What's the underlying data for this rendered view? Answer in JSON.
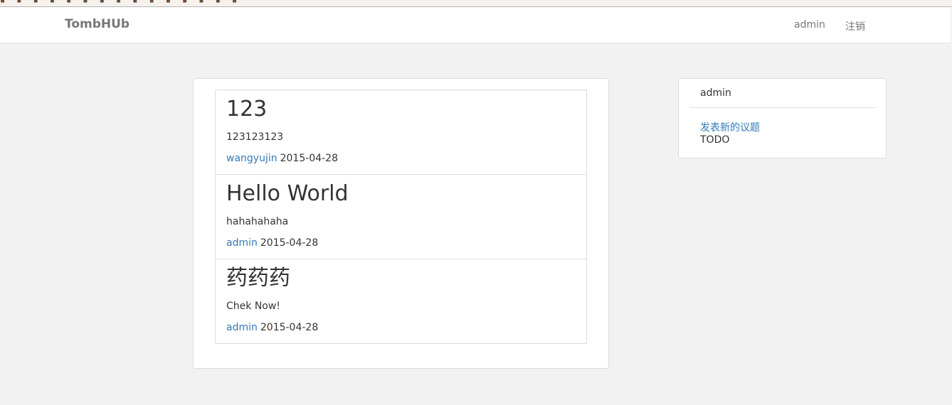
{
  "navbar": {
    "brand": "TombHUb",
    "user_link": "admin",
    "logout_link": "注销"
  },
  "topics": [
    {
      "title": "123",
      "body": "123123123",
      "author": "wangyujin",
      "date": "2015-04-28"
    },
    {
      "title": "Hello World",
      "body": "hahahahaha",
      "author": "admin",
      "date": "2015-04-28"
    },
    {
      "title": "药药药",
      "body": "Chek Now!",
      "author": "admin",
      "date": "2015-04-28"
    }
  ],
  "sidebar": {
    "username": "admin",
    "new_topic_link": "发表新的议题",
    "todo_text": "TODO"
  },
  "colors": {
    "page_background": "#f2f2f2",
    "link": "#337ab7",
    "text": "#333333",
    "nav_text": "#777777",
    "border": "#dcdcdc"
  }
}
